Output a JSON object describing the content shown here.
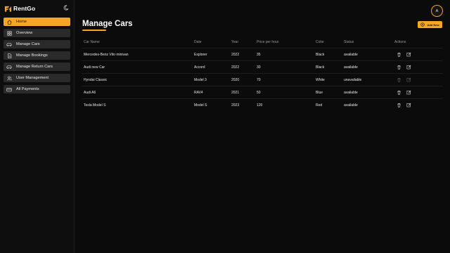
{
  "brand": {
    "name": "RentGo",
    "accent": "#f5a623"
  },
  "sidebar": {
    "items": [
      {
        "label": "Home",
        "icon": "home-icon",
        "active": true
      },
      {
        "label": "Overview",
        "icon": "grid-icon",
        "active": false
      },
      {
        "label": "Manage Cars",
        "icon": "car-icon",
        "active": false
      },
      {
        "label": "Manage Bookings",
        "icon": "document-icon",
        "active": false
      },
      {
        "label": "Manage Return Cars",
        "icon": "car-return-icon",
        "active": false
      },
      {
        "label": "User Management",
        "icon": "users-icon",
        "active": false
      },
      {
        "label": "All Payments",
        "icon": "credit-card-icon",
        "active": false
      }
    ]
  },
  "header": {
    "avatar_initial": "A"
  },
  "page": {
    "title": "Manage Cars",
    "add_button_label": "Add New"
  },
  "table": {
    "columns": [
      "Car Name",
      "Date",
      "Year",
      "Price per hour",
      "Color",
      "Status",
      "Actions"
    ],
    "rows": [
      {
        "car_name": "Mercedes-Benz Vito minivan",
        "date": "Explorer",
        "year": "2022",
        "price": "35",
        "color": "Black",
        "status": "available"
      },
      {
        "car_name": "Audi new Car",
        "date": "Accord",
        "year": "2022",
        "price": "30",
        "color": "Black",
        "status": "available"
      },
      {
        "car_name": "Hyndai Classic",
        "date": "Model 3",
        "year": "2020",
        "price": "70",
        "color": "White",
        "status": "unavailable"
      },
      {
        "car_name": "Audi A6",
        "date": "RAV4",
        "year": "2021",
        "price": "50",
        "color": "Blue",
        "status": "available"
      },
      {
        "car_name": "Tesla Model S",
        "date": "Model S",
        "year": "2023",
        "price": "120",
        "color": "Red",
        "status": "available"
      }
    ]
  }
}
